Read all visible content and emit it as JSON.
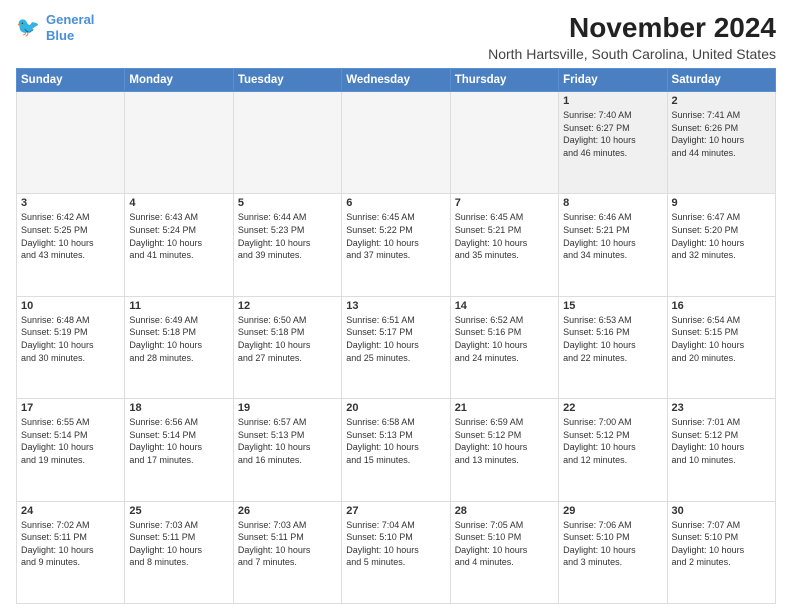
{
  "logo": {
    "line1": "General",
    "line2": "Blue"
  },
  "title": "November 2024",
  "location": "North Hartsville, South Carolina, United States",
  "days_of_week": [
    "Sunday",
    "Monday",
    "Tuesday",
    "Wednesday",
    "Thursday",
    "Friday",
    "Saturday"
  ],
  "weeks": [
    [
      {
        "day": "",
        "empty": true
      },
      {
        "day": "",
        "empty": true
      },
      {
        "day": "",
        "empty": true
      },
      {
        "day": "",
        "empty": true
      },
      {
        "day": "",
        "empty": true
      },
      {
        "day": "1",
        "info": "Sunrise: 7:40 AM\nSunset: 6:27 PM\nDaylight: 10 hours\nand 46 minutes."
      },
      {
        "day": "2",
        "info": "Sunrise: 7:41 AM\nSunset: 6:26 PM\nDaylight: 10 hours\nand 44 minutes."
      }
    ],
    [
      {
        "day": "3",
        "info": "Sunrise: 6:42 AM\nSunset: 5:25 PM\nDaylight: 10 hours\nand 43 minutes."
      },
      {
        "day": "4",
        "info": "Sunrise: 6:43 AM\nSunset: 5:24 PM\nDaylight: 10 hours\nand 41 minutes."
      },
      {
        "day": "5",
        "info": "Sunrise: 6:44 AM\nSunset: 5:23 PM\nDaylight: 10 hours\nand 39 minutes."
      },
      {
        "day": "6",
        "info": "Sunrise: 6:45 AM\nSunset: 5:22 PM\nDaylight: 10 hours\nand 37 minutes."
      },
      {
        "day": "7",
        "info": "Sunrise: 6:45 AM\nSunset: 5:21 PM\nDaylight: 10 hours\nand 35 minutes."
      },
      {
        "day": "8",
        "info": "Sunrise: 6:46 AM\nSunset: 5:21 PM\nDaylight: 10 hours\nand 34 minutes."
      },
      {
        "day": "9",
        "info": "Sunrise: 6:47 AM\nSunset: 5:20 PM\nDaylight: 10 hours\nand 32 minutes."
      }
    ],
    [
      {
        "day": "10",
        "info": "Sunrise: 6:48 AM\nSunset: 5:19 PM\nDaylight: 10 hours\nand 30 minutes."
      },
      {
        "day": "11",
        "info": "Sunrise: 6:49 AM\nSunset: 5:18 PM\nDaylight: 10 hours\nand 28 minutes."
      },
      {
        "day": "12",
        "info": "Sunrise: 6:50 AM\nSunset: 5:18 PM\nDaylight: 10 hours\nand 27 minutes."
      },
      {
        "day": "13",
        "info": "Sunrise: 6:51 AM\nSunset: 5:17 PM\nDaylight: 10 hours\nand 25 minutes."
      },
      {
        "day": "14",
        "info": "Sunrise: 6:52 AM\nSunset: 5:16 PM\nDaylight: 10 hours\nand 24 minutes."
      },
      {
        "day": "15",
        "info": "Sunrise: 6:53 AM\nSunset: 5:16 PM\nDaylight: 10 hours\nand 22 minutes."
      },
      {
        "day": "16",
        "info": "Sunrise: 6:54 AM\nSunset: 5:15 PM\nDaylight: 10 hours\nand 20 minutes."
      }
    ],
    [
      {
        "day": "17",
        "info": "Sunrise: 6:55 AM\nSunset: 5:14 PM\nDaylight: 10 hours\nand 19 minutes."
      },
      {
        "day": "18",
        "info": "Sunrise: 6:56 AM\nSunset: 5:14 PM\nDaylight: 10 hours\nand 17 minutes."
      },
      {
        "day": "19",
        "info": "Sunrise: 6:57 AM\nSunset: 5:13 PM\nDaylight: 10 hours\nand 16 minutes."
      },
      {
        "day": "20",
        "info": "Sunrise: 6:58 AM\nSunset: 5:13 PM\nDaylight: 10 hours\nand 15 minutes."
      },
      {
        "day": "21",
        "info": "Sunrise: 6:59 AM\nSunset: 5:12 PM\nDaylight: 10 hours\nand 13 minutes."
      },
      {
        "day": "22",
        "info": "Sunrise: 7:00 AM\nSunset: 5:12 PM\nDaylight: 10 hours\nand 12 minutes."
      },
      {
        "day": "23",
        "info": "Sunrise: 7:01 AM\nSunset: 5:12 PM\nDaylight: 10 hours\nand 10 minutes."
      }
    ],
    [
      {
        "day": "24",
        "info": "Sunrise: 7:02 AM\nSunset: 5:11 PM\nDaylight: 10 hours\nand 9 minutes."
      },
      {
        "day": "25",
        "info": "Sunrise: 7:03 AM\nSunset: 5:11 PM\nDaylight: 10 hours\nand 8 minutes."
      },
      {
        "day": "26",
        "info": "Sunrise: 7:03 AM\nSunset: 5:11 PM\nDaylight: 10 hours\nand 7 minutes."
      },
      {
        "day": "27",
        "info": "Sunrise: 7:04 AM\nSunset: 5:10 PM\nDaylight: 10 hours\nand 5 minutes."
      },
      {
        "day": "28",
        "info": "Sunrise: 7:05 AM\nSunset: 5:10 PM\nDaylight: 10 hours\nand 4 minutes."
      },
      {
        "day": "29",
        "info": "Sunrise: 7:06 AM\nSunset: 5:10 PM\nDaylight: 10 hours\nand 3 minutes."
      },
      {
        "day": "30",
        "info": "Sunrise: 7:07 AM\nSunset: 5:10 PM\nDaylight: 10 hours\nand 2 minutes."
      }
    ]
  ]
}
